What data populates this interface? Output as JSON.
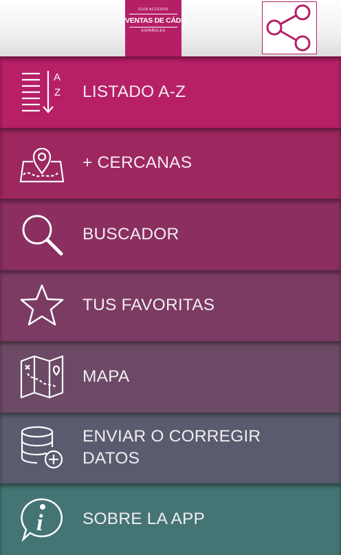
{
  "header": {
    "logo": {
      "top_text": "GUÍA ACCESOS",
      "title": "VENTAS DE CÁDIZ",
      "bottom_text": "ESPAÑOLES"
    },
    "share_icon": "share-icon"
  },
  "menu": {
    "items": [
      {
        "label": "LISTADO A-Z",
        "icon": "sort-az-icon",
        "color": "#b71f66"
      },
      {
        "label": "+ CERCANAS",
        "icon": "map-pin-icon",
        "color": "#9d275f"
      },
      {
        "label": "BUSCADOR",
        "icon": "search-icon",
        "color": "#8a2f60"
      },
      {
        "label": "TUS FAVORITAS",
        "icon": "star-icon",
        "color": "#7c3b63"
      },
      {
        "label": "MAPA",
        "icon": "map-icon",
        "color": "#6c4a66"
      },
      {
        "label": "ENVIAR O CORREGIR DATOS",
        "icon": "database-add-icon",
        "color": "#585c6e"
      },
      {
        "label": "SOBRE LA APP",
        "icon": "info-icon",
        "color": "#447574"
      }
    ]
  }
}
